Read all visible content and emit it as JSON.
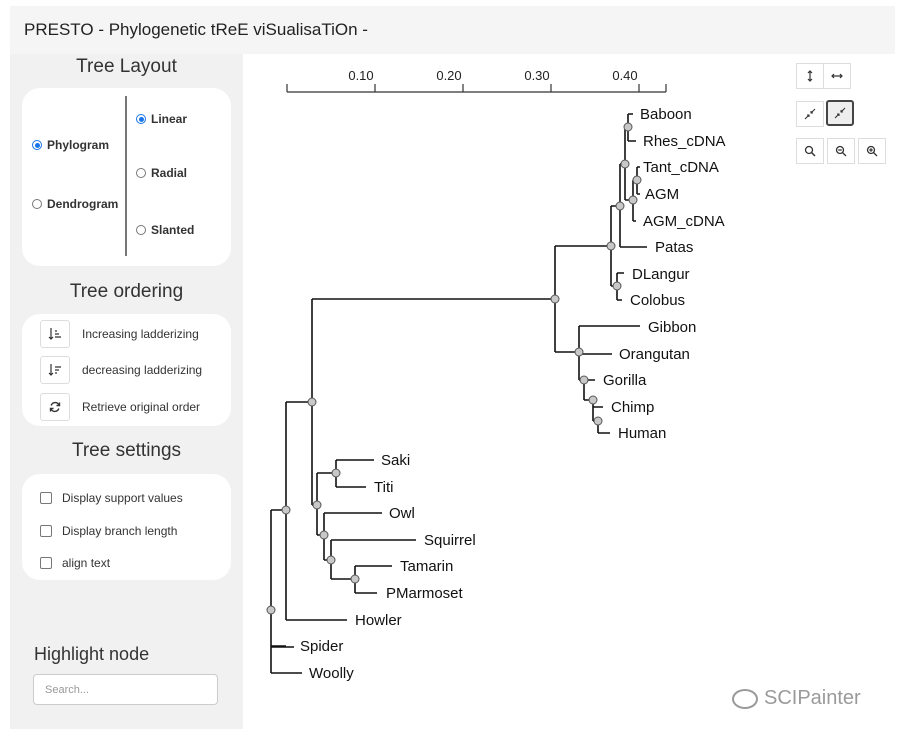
{
  "title": "PRESTO - Phylogenetic tReE viSualisaTiOn -",
  "sidebar": {
    "layout_title": "Tree Layout",
    "layout_types": [
      {
        "label": "Phylogram",
        "selected": true
      },
      {
        "label": "Dendrogram",
        "selected": false
      }
    ],
    "layout_shapes": [
      {
        "label": "Linear",
        "selected": true
      },
      {
        "label": "Radial",
        "selected": false
      },
      {
        "label": "Slanted",
        "selected": false
      }
    ],
    "ordering_title": "Tree ordering",
    "ordering": [
      {
        "label": "Increasing ladderizing",
        "icon": "sort-ascending-icon"
      },
      {
        "label": "decreasing ladderizing",
        "icon": "sort-descending-icon"
      },
      {
        "label": "Retrieve original order",
        "icon": "refresh-icon"
      }
    ],
    "settings_title": "Tree settings",
    "settings": [
      {
        "label": "Display support values",
        "checked": false
      },
      {
        "label": "Display branch length",
        "checked": false
      },
      {
        "label": "align text",
        "checked": false
      }
    ],
    "highlight_title": "Highlight node",
    "search_placeholder": "Search..."
  },
  "toolbar": {
    "buttons": [
      "expand-vertical",
      "expand-horizontal",
      "shrink",
      "shrink-active",
      "zoom-reset",
      "zoom-out",
      "zoom-in"
    ]
  },
  "tree": {
    "scale_ticks": [
      "0.10",
      "0.20",
      "0.30",
      "0.40"
    ],
    "leaves": [
      "Baboon",
      "Rhes_cDNA",
      "Tant_cDNA",
      "AGM",
      "AGM_cDNA",
      "Patas",
      "DLangur",
      "Colobus",
      "Gibbon",
      "Orangutan",
      "Gorilla",
      "Chimp",
      "Human",
      "Saki",
      "Titi",
      "Owl",
      "Squirrel",
      "Tamarin",
      "PMarmoset",
      "Howler",
      "Spider",
      "Woolly"
    ]
  },
  "watermark": "SCIPainter",
  "colors": {
    "radio_accent": "#1a73e8",
    "node_fill": "#c8c8c8"
  }
}
